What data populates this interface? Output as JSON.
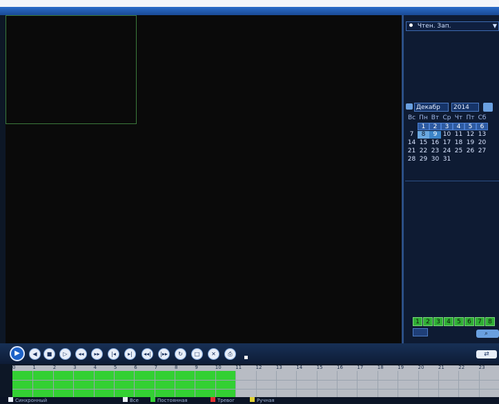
{
  "mode": {
    "label": "Чтен. Зап."
  },
  "calendar": {
    "month": "Декабр",
    "year": "2014",
    "weekdays": [
      "Вс",
      "Пн",
      "Вт",
      "Ср",
      "Чт",
      "Пт",
      "Сб"
    ],
    "rows": [
      [
        "",
        "1",
        "2",
        "3",
        "4",
        "5",
        "6"
      ],
      [
        "7",
        "8",
        "9",
        "10",
        "11",
        "12",
        "13"
      ],
      [
        "14",
        "15",
        "16",
        "17",
        "18",
        "19",
        "20"
      ],
      [
        "21",
        "22",
        "23",
        "24",
        "25",
        "26",
        "27"
      ],
      [
        "28",
        "29",
        "30",
        "31",
        "",
        "",
        ""
      ]
    ]
  },
  "channels": [
    "1",
    "2",
    "3",
    "4",
    "5",
    "6",
    "7",
    "8"
  ],
  "timeline": {
    "hours": [
      "0",
      "1",
      "2",
      "3",
      "4",
      "5",
      "6",
      "7",
      "8",
      "9",
      "10",
      "11",
      "12",
      "13",
      "14",
      "15",
      "16",
      "17",
      "18",
      "19",
      "20",
      "21",
      "22",
      "23"
    ],
    "recorded_until_hour": 11
  },
  "legend": {
    "sync": "Синхронный",
    "all": "Все",
    "continuous": "Постоянная",
    "alarm": "Тревог",
    "manual": "Ручная"
  },
  "colors": {
    "continuous": "#33d033",
    "alarm": "#e03030",
    "manual": "#e0d030"
  }
}
